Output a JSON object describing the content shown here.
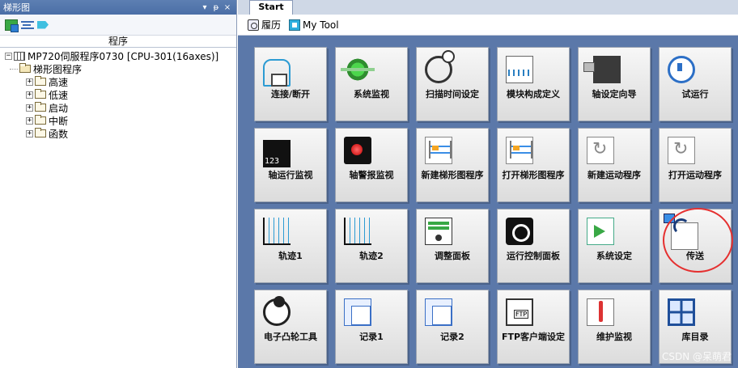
{
  "left_panel": {
    "title": "梯形图",
    "title_buttons": [
      "▾",
      "ᵽ",
      "×"
    ],
    "column_header": "程序",
    "tree": {
      "root": "MP720伺服程序0730 [CPU-301(16axes)]",
      "child": "梯形图程序",
      "items": [
        "高速",
        "低速",
        "启动",
        "中断",
        "函数"
      ]
    }
  },
  "tabs": [
    {
      "label": "Start"
    }
  ],
  "toolbar": {
    "history_label": "履历",
    "mytool_label": "My Tool"
  },
  "tiles": [
    {
      "label": "连接/断开",
      "icon": "connect-icon"
    },
    {
      "label": "系统监视",
      "icon": "system-monitor-icon"
    },
    {
      "label": "扫描时间设定",
      "icon": "scan-time-icon"
    },
    {
      "label": "模块构成定义",
      "icon": "module-config-icon"
    },
    {
      "label": "轴设定向导",
      "icon": "axis-setup-icon"
    },
    {
      "label": "试运行",
      "icon": "trial-run-icon"
    },
    {
      "label": "轴运行监视",
      "icon": "axis-monitor-icon"
    },
    {
      "label": "轴警报监视",
      "icon": "axis-alarm-icon"
    },
    {
      "label": "新建梯形图程序",
      "icon": "new-ladder-icon"
    },
    {
      "label": "打开梯形图程序",
      "icon": "open-ladder-icon"
    },
    {
      "label": "新建运动程序",
      "icon": "new-motion-icon"
    },
    {
      "label": "打开运动程序",
      "icon": "open-motion-icon"
    },
    {
      "label": "轨迹1",
      "icon": "trace-icon"
    },
    {
      "label": "轨迹2",
      "icon": "trace-icon"
    },
    {
      "label": "调整面板",
      "icon": "tuning-panel-icon"
    },
    {
      "label": "运行控制面板",
      "icon": "control-panel-icon"
    },
    {
      "label": "系统设定",
      "icon": "system-settings-icon"
    },
    {
      "label": "传送",
      "icon": "transfer-icon"
    },
    {
      "label": "电子凸轮工具",
      "icon": "cam-tool-icon"
    },
    {
      "label": "记录1",
      "icon": "record-icon"
    },
    {
      "label": "记录2",
      "icon": "record-icon"
    },
    {
      "label": "FTP客户端设定",
      "icon": "ftp-icon"
    },
    {
      "label": "维护监视",
      "icon": "maintenance-icon"
    },
    {
      "label": "库目录",
      "icon": "library-icon"
    }
  ],
  "watermark": "CSDN @呆萌君",
  "colors": {
    "workspace_bg": "#5b78a9",
    "highlight_circle": "#e53030"
  }
}
